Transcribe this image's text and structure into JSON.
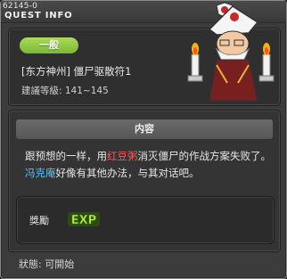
{
  "window": {
    "quest_id": "62145-0",
    "title": "QUEST INFO"
  },
  "quest": {
    "category_badge": "一般",
    "name": "[东方神州] 僵尸驱散符1",
    "level": "建議等級: 141~145"
  },
  "content": {
    "section_title": "内容",
    "description_parts": {
      "p1": "跟预想的一样，用",
      "item": "红豆粥",
      "p2": "消灭僵尸的作战方案失败了。",
      "npc": "冯克庵",
      "p3": "好像有其他办法，与其对话吧。"
    }
  },
  "reward": {
    "label": "獎勵",
    "exp_text": "EXP"
  },
  "status": {
    "text": "狀態: 可開始"
  },
  "colors": {
    "accent_green": "#8cc63f",
    "highlight_red": "#ff5a5a",
    "highlight_blue": "#4cc7ff"
  }
}
